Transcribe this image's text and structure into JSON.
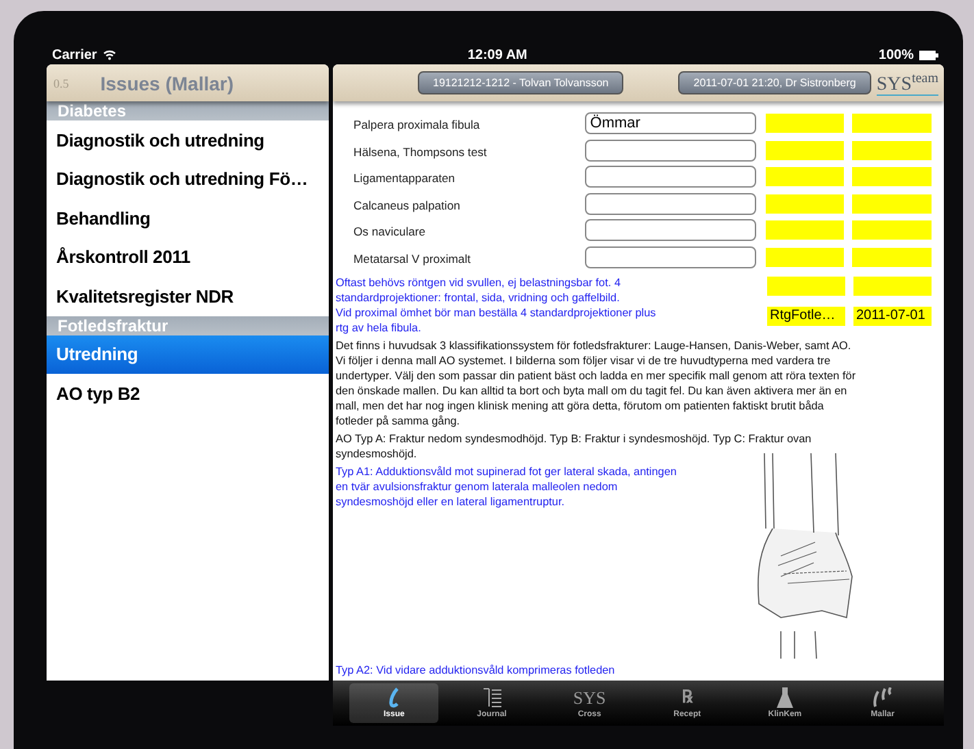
{
  "status_bar": {
    "carrier": "Carrier",
    "time": "12:09 AM",
    "battery": "100%"
  },
  "sidebar": {
    "version": "0.5",
    "title": "Issues (Mallar)",
    "sections": [
      {
        "title": "Diabetes",
        "items": [
          {
            "label": "Diagnostik och utredning",
            "selected": false
          },
          {
            "label": "Diagnostik och utredning Fö…",
            "selected": false
          },
          {
            "label": "Behandling",
            "selected": false
          },
          {
            "label": "Årskontroll 2011",
            "selected": false
          },
          {
            "label": "Kvalitetsregister NDR",
            "selected": false
          }
        ]
      },
      {
        "title": "Fotledsfraktur",
        "items": [
          {
            "label": "Utredning",
            "selected": true
          },
          {
            "label": "AO typ B2",
            "selected": false
          }
        ]
      }
    ]
  },
  "header": {
    "patient": "19121212-1212 - Tolvan Tolvansson",
    "visit": "2011-07-01 21:20, Dr Sistronberg",
    "logo": "SYS$^{team}$"
  },
  "rows": [
    {
      "kind": "field",
      "label": "Palpera proximala fibula",
      "value": "Ömmar"
    },
    {
      "kind": "field",
      "label": "Hälsena, Thompsons test"
    },
    {
      "kind": "field",
      "label": "Ligamentapparaten"
    },
    {
      "kind": "field",
      "label": "Calcaneus palpation"
    },
    {
      "kind": "field",
      "label": "Os naviculare"
    },
    {
      "kind": "field",
      "label": "Metatarsal V proximalt"
    },
    {
      "kind": "note",
      "label": "Oftast behövs röntgen vid svullen, ej belastningsbar fot. 4 standardprojektioner: frontal, sida, vridning och gaffelbild."
    },
    {
      "kind": "note",
      "label": "Vid proximal ömhet bör man beställa 4 standardprojektioner plus rtg av hela fibula.",
      "col_1": "RtgFotle…",
      "col_2": "2011-07-01"
    }
  ],
  "paragraphs": [
    {
      "kind": "body",
      "text": "Det finns i huvudsak 3 klassifikationssystem för fotledsfrakturer: Lauge-Hansen, Danis-Weber, samt AO. Vi följer i denna mall AO systemet. I bilderna som följer visar vi de tre huvudtyperna med vardera tre undertyper. Välj den som passar din patient bäst och ladda en mer specifik mall genom att röra texten för den önskade mallen. Du kan alltid ta bort och byta mall om du tagit fel. Du kan även aktivera mer än en mall, men det har nog ingen klinisk mening att göra detta, förutom om patienten faktiskt brutit båda fotleder på samma gång."
    },
    {
      "kind": "body",
      "text": "AO Typ A: Fraktur nedom syndesmodhöjd. Typ B: Fraktur i syndesmoshöjd. Typ C: Fraktur ovan syndesmoshöjd."
    }
  ],
  "types": [
    {
      "text": "Typ A1: Adduktionsvåld mot supinerad fot ger lateral skada, antingen en tvär avulsionsfraktur genom laterala malleolen nedom syndesmoshöjd eller en lateral ligamentruptur."
    },
    {
      "text": "Typ A2: Vid vidare adduktionsvåld komprimeras fotleden"
    }
  ],
  "tabs": [
    {
      "kind": "issue",
      "label": "Issue",
      "selected": true
    },
    {
      "kind": "journal",
      "label": "Journal",
      "selected": false
    },
    {
      "kind": "cross",
      "label": "Cross",
      "glyph": "SYS",
      "selected": false
    },
    {
      "kind": "recept",
      "label": "Recept",
      "glyph": "℞",
      "selected": false
    },
    {
      "kind": "klinkem",
      "label": "KlinKem",
      "selected": false
    },
    {
      "kind": "mallar",
      "label": "Mallar",
      "selected": false
    }
  ]
}
